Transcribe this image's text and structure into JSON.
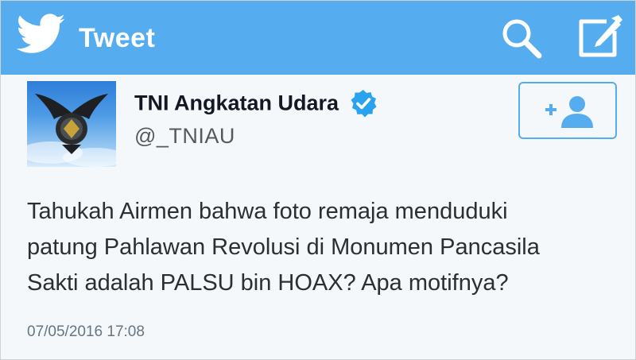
{
  "topbar": {
    "title": "Tweet",
    "color": "#55acee",
    "bird_icon": "twitter-bird-icon",
    "search_icon": "search-icon",
    "compose_icon": "compose-icon"
  },
  "tweet": {
    "display_name": "TNI Angkatan Udara",
    "handle": "@_TNIAU",
    "verified_icon": "verified-badge-icon",
    "follow_icon": "follow-user-icon",
    "text_lines": [
      "Tahukah Airmen bahwa foto remaja menduduki",
      "patung Pahlawan Revolusi di Monumen Pancasila",
      "Sakti adalah PALSU bin HOAX? Apa motifnya?"
    ],
    "timestamp": "07/05/2016 17:08"
  }
}
